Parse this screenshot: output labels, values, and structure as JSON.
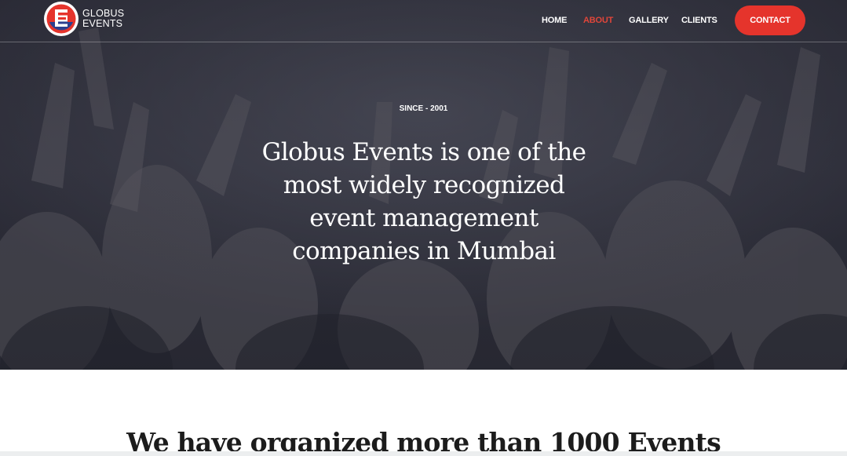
{
  "brand": {
    "name_line1": "GLOBUS",
    "name_line2": "EVENTS",
    "logo_letter": "E",
    "colors": {
      "red": "#e5342c",
      "blue": "#2b3f8f"
    }
  },
  "nav": {
    "items": [
      {
        "label": "HOME",
        "active": false
      },
      {
        "label": "ABOUT",
        "active": true
      },
      {
        "label": "GALLERY",
        "active": false
      },
      {
        "label": "CLIENTS",
        "active": false
      }
    ],
    "contact_label": "CONTACT",
    "active_color": "#e0463a"
  },
  "hero": {
    "eyebrow": "SINCE - 2001",
    "title_lines": [
      "Globus Events is one of the",
      "most widely recognized",
      "event management",
      "companies in Mumbai"
    ]
  },
  "section": {
    "title": "We have organized more than 1000 Events"
  }
}
